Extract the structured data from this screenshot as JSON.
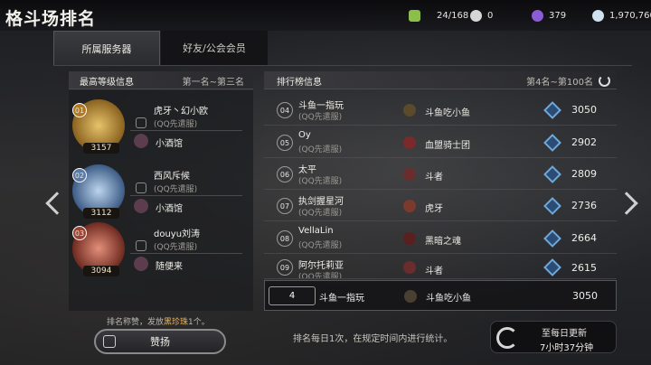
{
  "title": "格斗场排名",
  "resources": [
    {
      "icon": "stamina-icon",
      "value": "24/168",
      "color": "#8bbf4a"
    },
    {
      "icon": "token-icon",
      "value": "0",
      "color": "#d6d6d6"
    },
    {
      "icon": "gem-icon",
      "value": "379",
      "color": "#8c5bd6"
    },
    {
      "icon": "coin-icon",
      "value": "1,970,760",
      "color": "#cfe0ef"
    }
  ],
  "tabs": [
    {
      "label": "所属服务器",
      "active": true
    },
    {
      "label": "好友/公会会员",
      "active": false
    }
  ],
  "left_panel": {
    "title": "最高等级信息",
    "range": "第一名~第三名",
    "players": [
      {
        "rank": "01",
        "points": "3157",
        "name": "虎牙丶幻小欧",
        "server": "(QQ先遣服)",
        "guild": "小酒馆",
        "emblem_color": "#c99a3a",
        "rank_color": "#b07a22"
      },
      {
        "rank": "02",
        "points": "3112",
        "name": "西风斥候",
        "server": "(QQ先遣服)",
        "guild": "小酒馆",
        "emblem_color": "#6f8db4",
        "rank_color": "#5a7aa6"
      },
      {
        "rank": "03",
        "points": "3094",
        "name": "douyu刘涛",
        "server": "(QQ先遣服)",
        "guild": "随便来",
        "emblem_color": "#b85a4a",
        "rank_color": "#9b4433"
      }
    ]
  },
  "right_panel": {
    "title": "排行榜信息",
    "range": "第4名~第100名",
    "rows": [
      {
        "rank": "04",
        "name": "斗鱼一指玩",
        "server": "(QQ先遣服)",
        "guild": "斗鱼吃小鱼",
        "score": "3050",
        "guild_color": "#5b4a2c"
      },
      {
        "rank": "05",
        "name": "Oy",
        "server": "(QQ先遣服)",
        "guild": "血盟骑士团",
        "score": "2902",
        "guild_color": "#7a2a2a"
      },
      {
        "rank": "06",
        "name": "太平",
        "server": "(QQ先遣服)",
        "guild": "斗者",
        "score": "2809",
        "guild_color": "#6a2d2d"
      },
      {
        "rank": "07",
        "name": "执剑握星河",
        "server": "(QQ先遣服)",
        "guild": "虎牙",
        "score": "2736",
        "guild_color": "#7a3a2e"
      },
      {
        "rank": "08",
        "name": "VellaLin",
        "server": "(QQ先遣服)",
        "guild": "黑暗之魂",
        "score": "2664",
        "guild_color": "#5a2020"
      },
      {
        "rank": "09",
        "name": "阿尔托莉亚",
        "server": "(QQ先遣服)",
        "guild": "斗者",
        "score": "2615",
        "guild_color": "#6a2d2d"
      }
    ],
    "mine": {
      "rank": "4",
      "name": "斗鱼一指玩",
      "guild": "斗鱼吃小鱼",
      "score": "3050"
    }
  },
  "bottom": {
    "note_prefix": "排名称赞，发放",
    "note_highlight": "黑珍珠",
    "note_suffix": "1个。",
    "praise_button": "赞扬",
    "footer": "排名每日1次，在规定时间内进行统计。",
    "update_title": "至每日更新",
    "update_time": "7小时37分钟"
  }
}
